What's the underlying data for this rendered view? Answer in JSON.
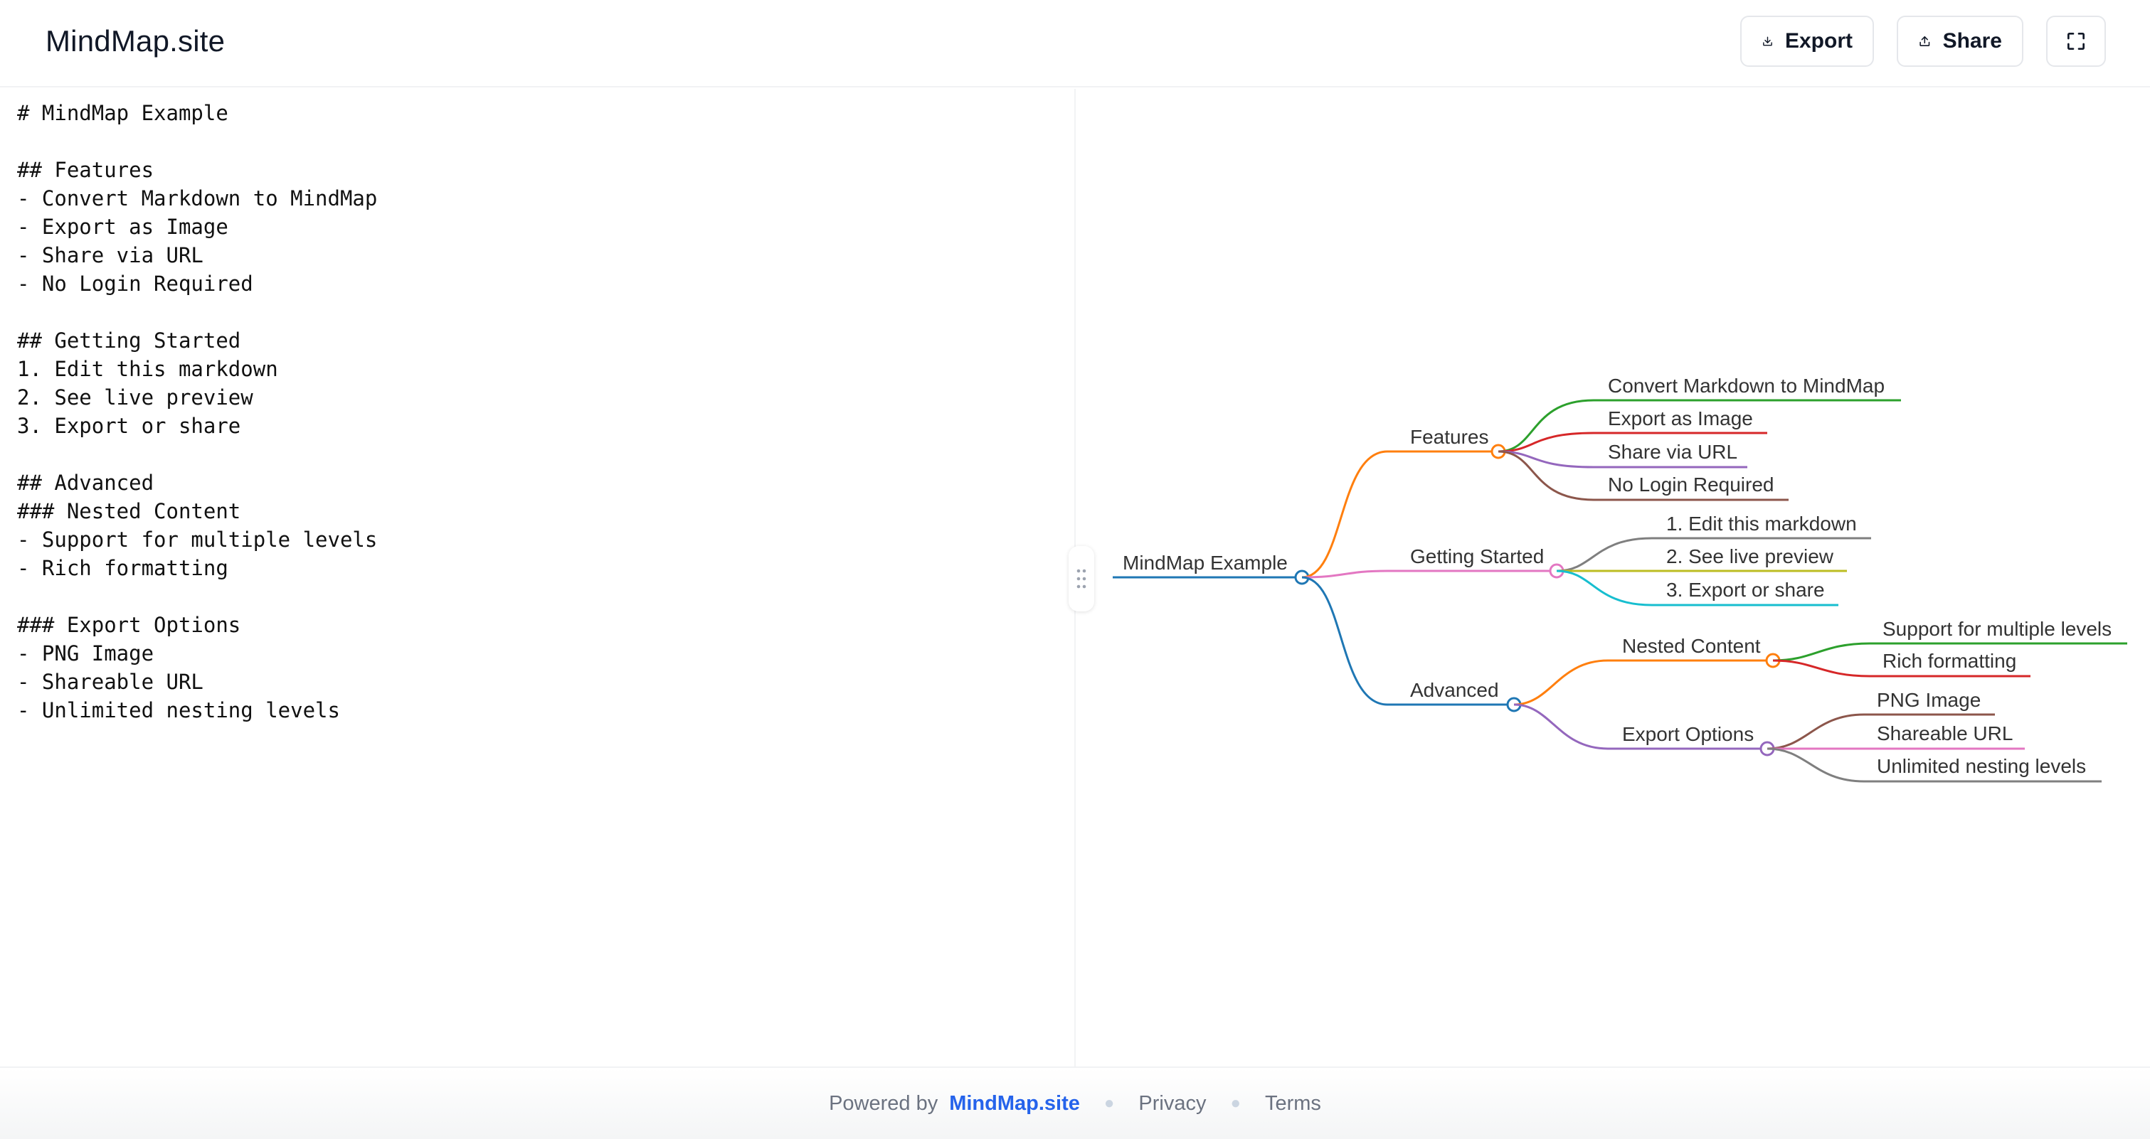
{
  "header": {
    "brand": "MindMap.site",
    "export_label": "Export",
    "share_label": "Share"
  },
  "editor": {
    "markdown": "# MindMap Example\n\n## Features\n- Convert Markdown to MindMap\n- Export as Image\n- Share via URL\n- No Login Required\n\n## Getting Started\n1. Edit this markdown\n2. See live preview\n3. Export or share\n\n## Advanced\n### Nested Content\n- Support for multiple levels\n- Rich formatting\n\n### Export Options\n- PNG Image\n- Shareable URL\n- Unlimited nesting levels"
  },
  "mindmap": {
    "root": "MindMap Example",
    "features": {
      "label": "Features",
      "items": [
        "Convert Markdown to MindMap",
        "Export as Image",
        "Share via URL",
        "No Login Required"
      ]
    },
    "getting_started": {
      "label": "Getting Started",
      "items": [
        "1. Edit this markdown",
        "2. See live preview",
        "3. Export or share"
      ]
    },
    "advanced": {
      "label": "Advanced",
      "nested": {
        "label": "Nested Content",
        "items": [
          "Support for multiple levels",
          "Rich formatting"
        ]
      },
      "export_options": {
        "label": "Export Options",
        "items": [
          "PNG Image",
          "Shareable URL",
          "Unlimited nesting levels"
        ]
      }
    },
    "colors": {
      "root": "#1f77b4",
      "features": "#ff7f0e",
      "getting_started": "#e377c2",
      "advanced": "#1f77b4",
      "green": "#2ca02c",
      "red": "#d62728",
      "purple": "#9467bd",
      "brown": "#8c564b",
      "gray": "#7f7f7f",
      "olive": "#bcbd22",
      "cyan": "#17becf"
    }
  },
  "footer": {
    "powered_by": "Powered by",
    "site": "MindMap.site",
    "privacy": "Privacy",
    "terms": "Terms"
  }
}
